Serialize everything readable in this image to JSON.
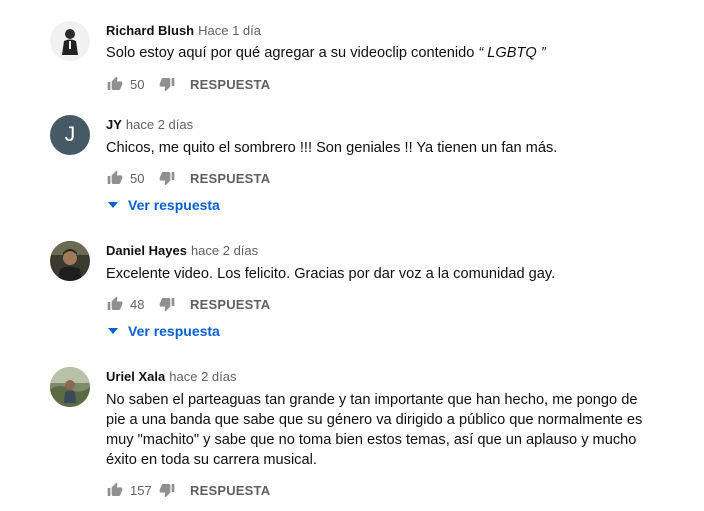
{
  "comments": [
    {
      "author": "Richard Blush",
      "time": "Hace 1 día",
      "text_before": "Solo estoy aquí por qué agregar a su videoclip contenido ",
      "text_emph": "“ LGBTQ ”",
      "likes": "50",
      "reply_label": "RESPUESTA"
    },
    {
      "author": "JY",
      "time": "hace 2 días",
      "avatar_letter": "J",
      "text": "Chicos, me quito el sombrero !!! Son geniales !! Ya tienen un fan más.",
      "likes": "50",
      "reply_label": "RESPUESTA",
      "view_replies": "Ver respuesta"
    },
    {
      "author": "Daniel Hayes",
      "time": "hace 2 días",
      "text": "Excelente video. Los felicito. Gracias por dar voz a la comunidad gay.",
      "likes": "48",
      "reply_label": "RESPUESTA",
      "view_replies": "Ver respuesta"
    },
    {
      "author": "Uriel Xala",
      "time": "hace 2 días",
      "text": "No saben el parteaguas tan grande y tan importante que han hecho, me pongo de pie a una banda que sabe que su género va dirigido a público que normalmente es muy \"machito\" y sabe que no toma bien estos temas, así que un aplauso y mucho éxito en toda su carrera musical.",
      "likes": "157",
      "reply_label": "RESPUESTA"
    }
  ],
  "colors": {
    "link": "#065fd4",
    "muted": "#606060",
    "avatar_jy": "#455a64"
  },
  "icons": [
    "thumb-up-icon",
    "thumb-down-icon",
    "caret-down-icon"
  ]
}
